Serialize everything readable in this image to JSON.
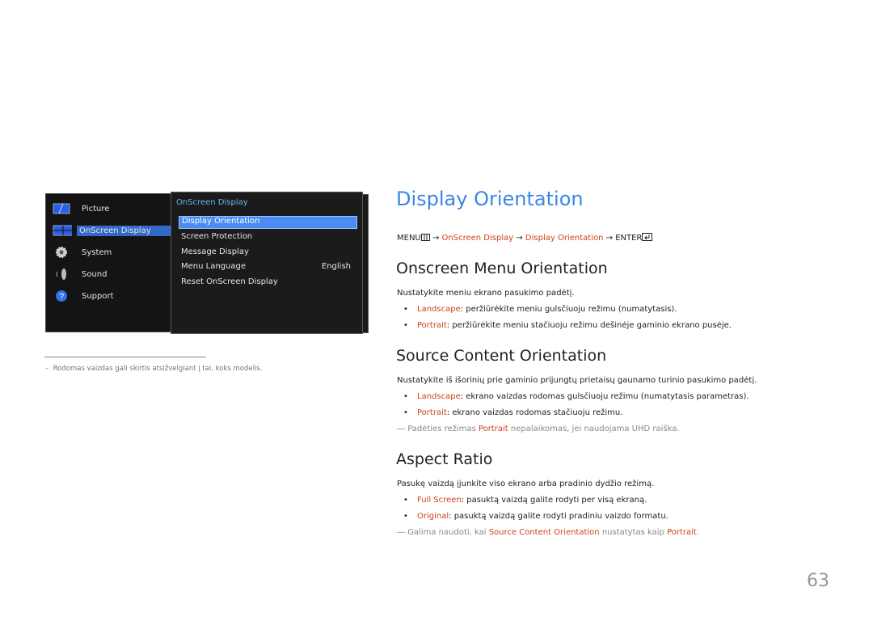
{
  "osd": {
    "main_menu": [
      {
        "label": "Picture",
        "icon": "picture-icon",
        "selected": false
      },
      {
        "label": "OnScreen Display",
        "icon": "onscreen-display-icon",
        "selected": true
      },
      {
        "label": "System",
        "icon": "gear-icon",
        "selected": false
      },
      {
        "label": "Sound",
        "icon": "speaker-icon",
        "selected": false
      },
      {
        "label": "Support",
        "icon": "question-icon",
        "selected": false
      }
    ],
    "submenu_title": "OnScreen Display",
    "submenu": [
      {
        "label": "Display Orientation",
        "value": "",
        "selected": true
      },
      {
        "label": "Screen Protection",
        "value": ""
      },
      {
        "label": "Message Display",
        "value": ""
      },
      {
        "label": "Menu Language",
        "value": "English"
      },
      {
        "label": "Reset OnScreen Display",
        "value": ""
      }
    ]
  },
  "footnote": "Rodomas vaizdas gali skirtis atsižvelgiant į tai, koks modelis.",
  "footnote_dash": "–",
  "title": "Display Orientation",
  "path": {
    "menu": "MENU",
    "arrow": "→",
    "step1": "OnScreen Display",
    "step2": "Display Orientation",
    "enter": "ENTER"
  },
  "sections": [
    {
      "heading": "Onscreen Menu Orientation",
      "intro": "Nustatykite meniu ekrano pasukimo padėtį.",
      "bullets": [
        {
          "term": "Landscape",
          "text": ": peržiūrėkite meniu gulsčiuoju režimu (numatytasis)."
        },
        {
          "term": "Portrait",
          "text": ": peržiūrėkite meniu stačiuoju režimu dešinėje gaminio ekrano pusėje."
        }
      ]
    },
    {
      "heading": "Source Content Orientation",
      "intro": "Nustatykite iš išorinių prie gaminio prijungtų prietaisų gaunamo turinio pasukimo padėtį.",
      "bullets": [
        {
          "term": "Landscape",
          "text": ": ekrano vaizdas rodomas gulsčiuoju režimu (numatytasis parametras)."
        },
        {
          "term": "Portrait",
          "text": ": ekrano vaizdas rodomas stačiuoju režimu."
        }
      ],
      "note": {
        "pre": "Padėties režimas ",
        "term": "Portrait",
        "post": " nepalaikomas, jei naudojama UHD raiška."
      }
    },
    {
      "heading": "Aspect Ratio",
      "intro": "Pasukę vaizdą įjunkite viso ekrano arba pradinio dydžio režimą.",
      "bullets": [
        {
          "term": "Full Screen",
          "text": ": pasuktą vaizdą galite rodyti per visą ekraną."
        },
        {
          "term": "Original",
          "text": ": pasuktą vaizdą galite rodyti pradiniu vaizdo formatu."
        }
      ],
      "note": {
        "pre": "Galima naudoti, kai ",
        "term": "Source Content Orientation",
        "mid": " nustatytas kaip ",
        "term2": "Portrait",
        "post": "."
      }
    }
  ],
  "bullet_glyph": "•",
  "note_glyph": "―",
  "page_number": "63",
  "colors": {
    "accent_blue": "#3a86e8",
    "term_red": "#d0401e",
    "osd_select": "#3269c8"
  }
}
